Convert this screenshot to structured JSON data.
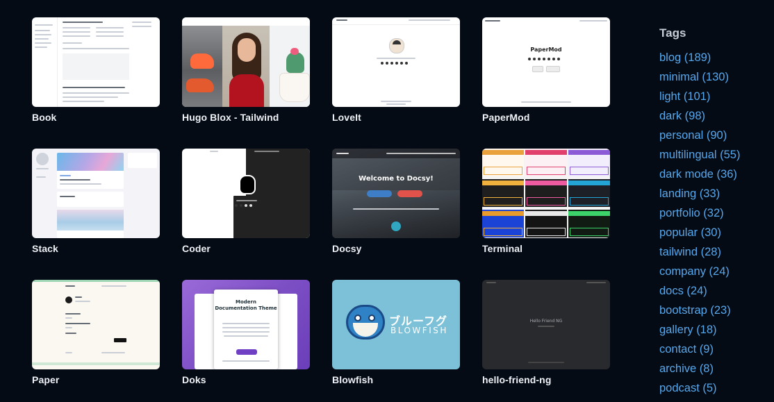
{
  "themes": [
    {
      "name": "Book"
    },
    {
      "name": "Hugo Blox - Tailwind"
    },
    {
      "name": "LoveIt"
    },
    {
      "name": "PaperMod"
    },
    {
      "name": "Stack"
    },
    {
      "name": "Coder"
    },
    {
      "name": "Docsy"
    },
    {
      "name": "Terminal"
    },
    {
      "name": "Paper"
    },
    {
      "name": "Doks"
    },
    {
      "name": "Blowfish"
    },
    {
      "name": "hello-friend-ng"
    }
  ],
  "previews": {
    "papermod_title": "PaperMod",
    "docsy_hero": "Welcome to Docsy!",
    "doks_title": "Modern Documentation Theme",
    "blowfish_jp": "ブルーフグ",
    "blowfish_en": "BLOWFISH",
    "hfng_title": "Hello Friend NG"
  },
  "tags": {
    "heading": "Tags",
    "items": [
      {
        "label": "blog (189)"
      },
      {
        "label": "minimal (130)"
      },
      {
        "label": "light (101)"
      },
      {
        "label": "dark (98)"
      },
      {
        "label": "personal (90)"
      },
      {
        "label": "multilingual (55)"
      },
      {
        "label": "dark mode (36)"
      },
      {
        "label": "landing (33)"
      },
      {
        "label": "portfolio (32)"
      },
      {
        "label": "popular (30)"
      },
      {
        "label": "tailwind (28)"
      },
      {
        "label": "company (24)"
      },
      {
        "label": "docs (24)"
      },
      {
        "label": "bootstrap (23)"
      },
      {
        "label": "gallery (18)"
      },
      {
        "label": "contact (9)"
      },
      {
        "label": "archive (8)"
      },
      {
        "label": "podcast (5)"
      }
    ]
  },
  "colors": {
    "background": "#050b14",
    "card_title": "#eef2f7",
    "tag_link": "#56a8ee",
    "tags_heading": "#c7cdd6"
  }
}
